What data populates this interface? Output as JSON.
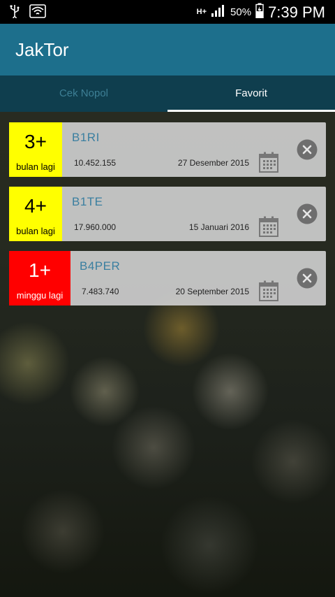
{
  "status_bar": {
    "usb_icon": "usb-icon",
    "wifi_icon": "wifi-icon",
    "network": "H+",
    "battery_percent": "50%",
    "time": "7:39 PM"
  },
  "app": {
    "title": "JakTor",
    "bar_color": "#1d6f8c"
  },
  "tabs": [
    {
      "label": "Cek Nopol",
      "selected": false
    },
    {
      "label": "Favorit",
      "selected": true
    }
  ],
  "favorites": [
    {
      "badge_number": "3+",
      "badge_unit": "bulan lagi",
      "badge_color": "#ffff00",
      "plate": "B1RI",
      "amount": "10.452.155",
      "date": "27 Desember 2015"
    },
    {
      "badge_number": "4+",
      "badge_unit": "bulan lagi",
      "badge_color": "#ffff00",
      "plate": "B1TE",
      "amount": "17.960.000",
      "date": "15 Januari 2016"
    },
    {
      "badge_number": "1+",
      "badge_unit": "minggu lagi",
      "badge_color": "#ff0000",
      "plate": "B4PER",
      "amount": "7.483.740",
      "date": "20 September 2015"
    }
  ]
}
